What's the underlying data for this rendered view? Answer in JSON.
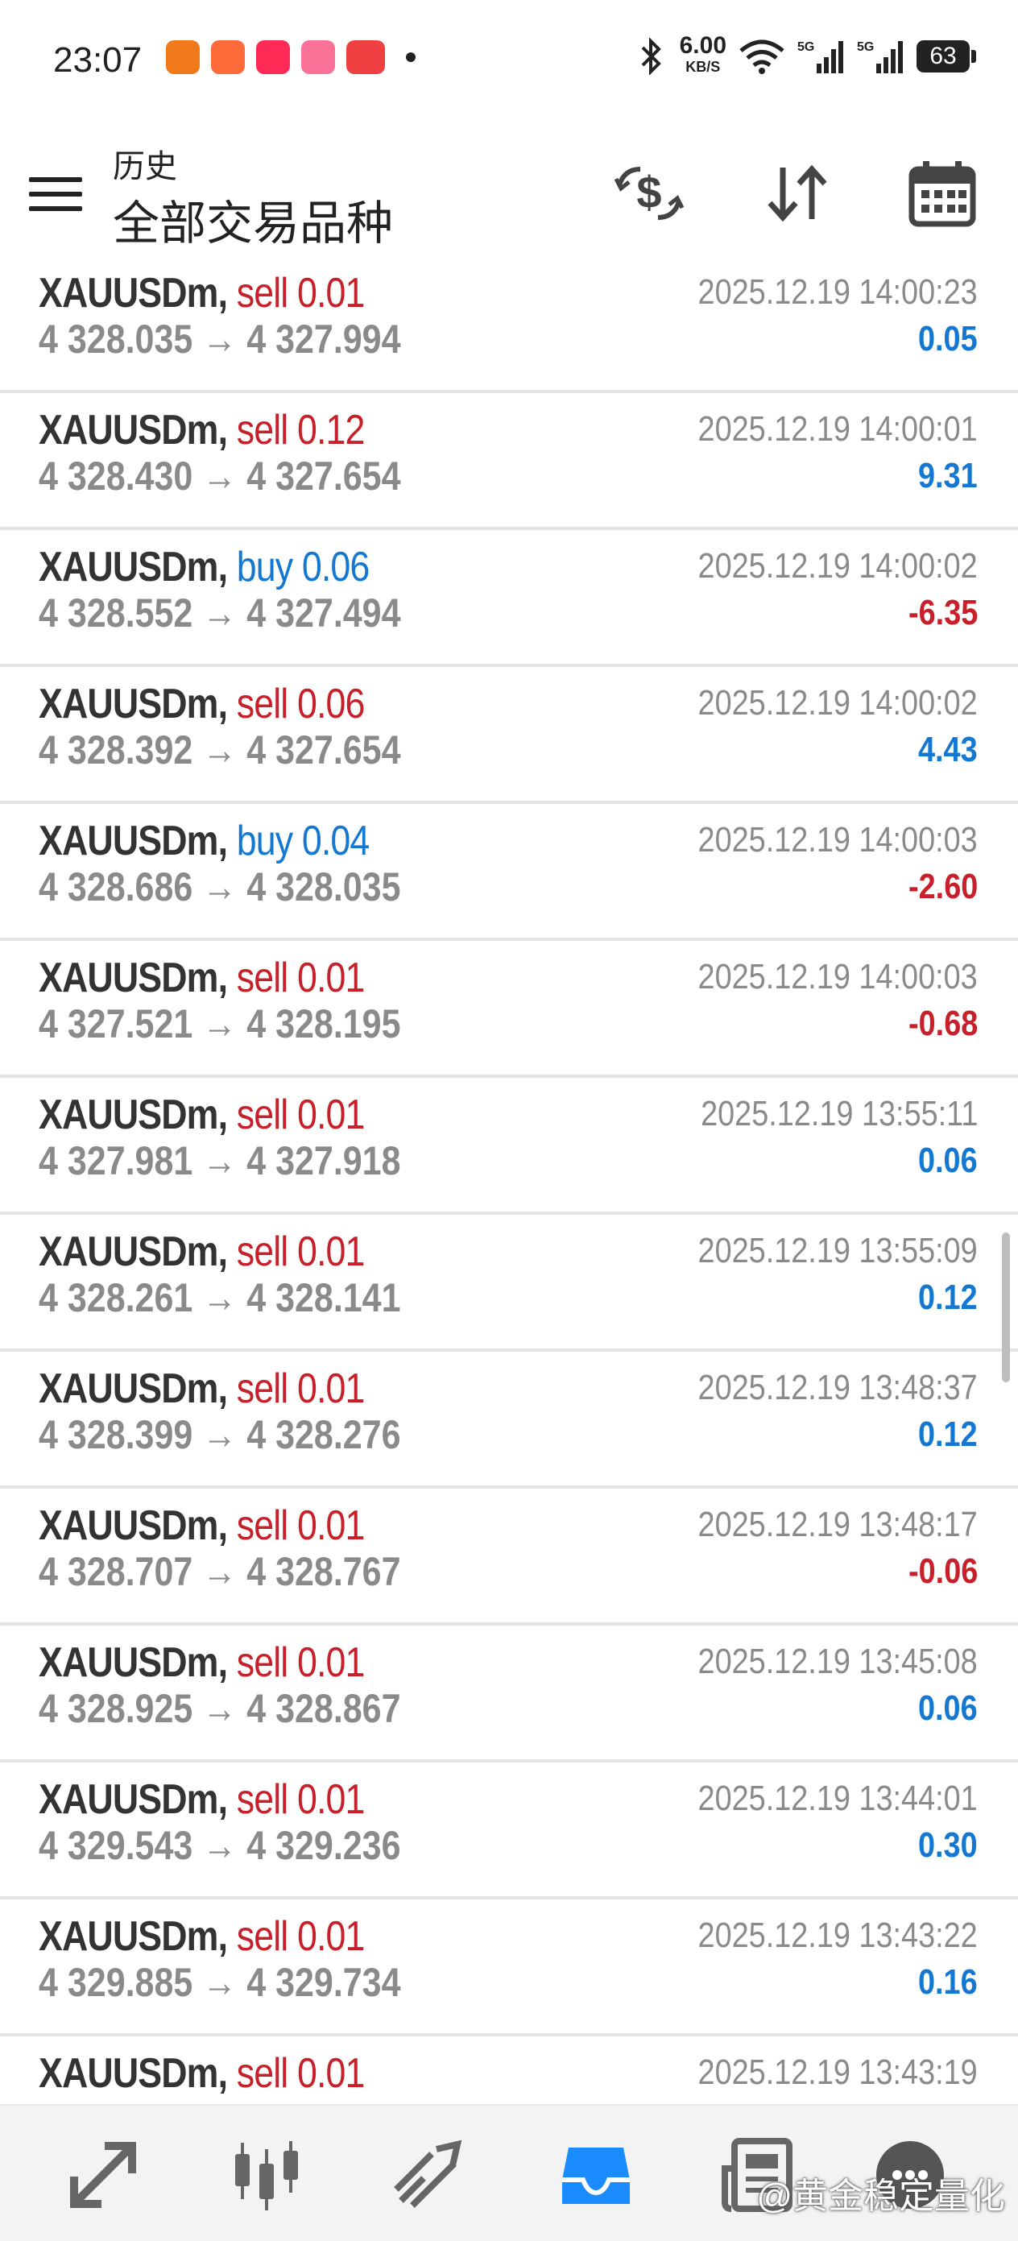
{
  "status_bar": {
    "time": "23:07",
    "net_speed": "6.00",
    "net_unit": "KB/S",
    "signal1": "5G",
    "signal2": "5G",
    "battery": "63"
  },
  "header": {
    "title": "历史",
    "subtitle": "全部交易品种"
  },
  "trades": [
    {
      "symbol": "XAUUSDm,",
      "side": "sell",
      "volume": "0.01",
      "open": "4 328.035",
      "close": "4 327.994",
      "time": "2025.12.19 14:00:23",
      "profit": "0.05",
      "profit_sign": "pos"
    },
    {
      "symbol": "XAUUSDm,",
      "side": "sell",
      "volume": "0.12",
      "open": "4 328.430",
      "close": "4 327.654",
      "time": "2025.12.19 14:00:01",
      "profit": "9.31",
      "profit_sign": "pos"
    },
    {
      "symbol": "XAUUSDm,",
      "side": "buy",
      "volume": "0.06",
      "open": "4 328.552",
      "close": "4 327.494",
      "time": "2025.12.19 14:00:02",
      "profit": "-6.35",
      "profit_sign": "neg"
    },
    {
      "symbol": "XAUUSDm,",
      "side": "sell",
      "volume": "0.06",
      "open": "4 328.392",
      "close": "4 327.654",
      "time": "2025.12.19 14:00:02",
      "profit": "4.43",
      "profit_sign": "pos"
    },
    {
      "symbol": "XAUUSDm,",
      "side": "buy",
      "volume": "0.04",
      "open": "4 328.686",
      "close": "4 328.035",
      "time": "2025.12.19 14:00:03",
      "profit": "-2.60",
      "profit_sign": "neg"
    },
    {
      "symbol": "XAUUSDm,",
      "side": "sell",
      "volume": "0.01",
      "open": "4 327.521",
      "close": "4 328.195",
      "time": "2025.12.19 14:00:03",
      "profit": "-0.68",
      "profit_sign": "neg"
    },
    {
      "symbol": "XAUUSDm,",
      "side": "sell",
      "volume": "0.01",
      "open": "4 327.981",
      "close": "4 327.918",
      "time": "2025.12.19 13:55:11",
      "profit": "0.06",
      "profit_sign": "pos"
    },
    {
      "symbol": "XAUUSDm,",
      "side": "sell",
      "volume": "0.01",
      "open": "4 328.261",
      "close": "4 328.141",
      "time": "2025.12.19 13:55:09",
      "profit": "0.12",
      "profit_sign": "pos"
    },
    {
      "symbol": "XAUUSDm,",
      "side": "sell",
      "volume": "0.01",
      "open": "4 328.399",
      "close": "4 328.276",
      "time": "2025.12.19 13:48:37",
      "profit": "0.12",
      "profit_sign": "pos"
    },
    {
      "symbol": "XAUUSDm,",
      "side": "sell",
      "volume": "0.01",
      "open": "4 328.707",
      "close": "4 328.767",
      "time": "2025.12.19 13:48:17",
      "profit": "-0.06",
      "profit_sign": "neg"
    },
    {
      "symbol": "XAUUSDm,",
      "side": "sell",
      "volume": "0.01",
      "open": "4 328.925",
      "close": "4 328.867",
      "time": "2025.12.19 13:45:08",
      "profit": "0.06",
      "profit_sign": "pos"
    },
    {
      "symbol": "XAUUSDm,",
      "side": "sell",
      "volume": "0.01",
      "open": "4 329.543",
      "close": "4 329.236",
      "time": "2025.12.19 13:44:01",
      "profit": "0.30",
      "profit_sign": "pos"
    },
    {
      "symbol": "XAUUSDm,",
      "side": "sell",
      "volume": "0.01",
      "open": "4 329.885",
      "close": "4 329.734",
      "time": "2025.12.19 13:43:22",
      "profit": "0.16",
      "profit_sign": "pos"
    },
    {
      "symbol": "XAUUSDm,",
      "side": "sell",
      "volume": "0.01",
      "open": "",
      "close": "",
      "time": "2025.12.19 13:43:19",
      "profit": "",
      "profit_sign": "pos"
    }
  ],
  "arrow": "→",
  "nav": {
    "items": [
      "quotes-icon",
      "chart-icon",
      "trade-icon",
      "history-icon",
      "news-icon",
      "messages-icon"
    ],
    "active": "history-icon"
  },
  "watermark": "@黄金稳定量化",
  "colors": {
    "sell": "#c8202a",
    "buy": "#1478d2",
    "positive": "#1478d2",
    "negative": "#c8202a",
    "active_nav": "#1a8cff"
  }
}
